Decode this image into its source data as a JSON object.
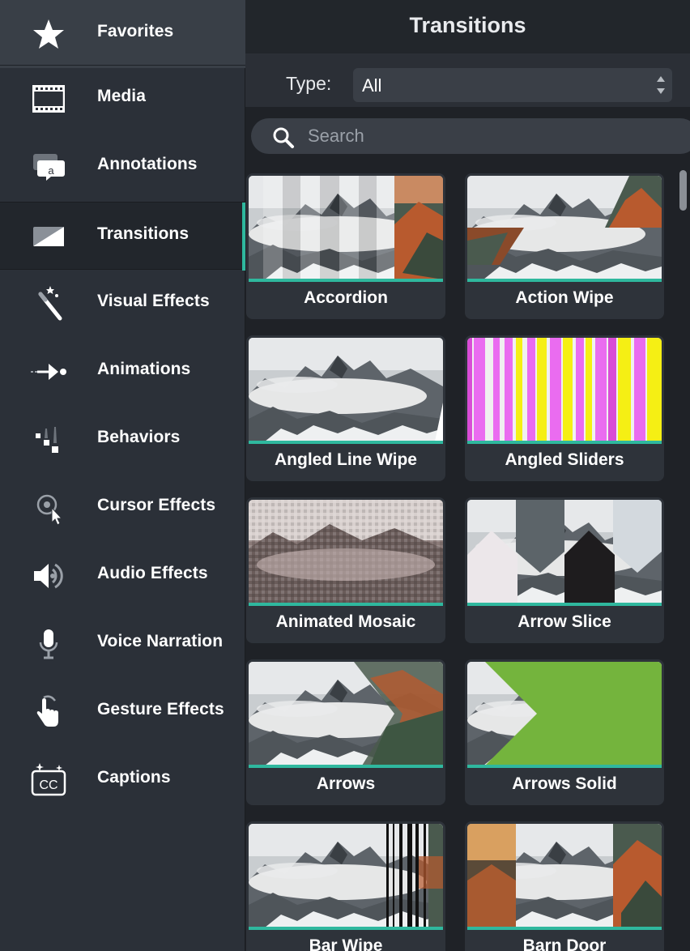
{
  "sidebar": {
    "items": [
      {
        "label": "Favorites",
        "icon": "star-icon"
      },
      {
        "label": "Media",
        "icon": "film-icon"
      },
      {
        "label": "Annotations",
        "icon": "annotation-icon"
      },
      {
        "label": "Transitions",
        "icon": "transition-icon"
      },
      {
        "label": "Visual Effects",
        "icon": "magic-wand-icon"
      },
      {
        "label": "Animations",
        "icon": "animation-arrow-icon"
      },
      {
        "label": "Behaviors",
        "icon": "behaviors-icon"
      },
      {
        "label": "Cursor Effects",
        "icon": "cursor-icon"
      },
      {
        "label": "Audio Effects",
        "icon": "speaker-icon"
      },
      {
        "label": "Voice Narration",
        "icon": "microphone-icon"
      },
      {
        "label": "Gesture Effects",
        "icon": "hand-icon"
      },
      {
        "label": "Captions",
        "icon": "captions-cc-icon"
      }
    ],
    "selected": "Transitions",
    "accent_color": "#2fb89e"
  },
  "header": {
    "title": "Transitions"
  },
  "filter": {
    "type_label": "Type:",
    "type_value": "All"
  },
  "search": {
    "placeholder": "Search"
  },
  "transitions": [
    {
      "name": "Accordion"
    },
    {
      "name": "Action Wipe"
    },
    {
      "name": "Angled Line Wipe"
    },
    {
      "name": "Angled Sliders"
    },
    {
      "name": "Animated Mosaic"
    },
    {
      "name": "Arrow Slice"
    },
    {
      "name": "Arrows"
    },
    {
      "name": "Arrows Solid"
    },
    {
      "name": "Bar Wipe"
    },
    {
      "name": "Barn Door"
    }
  ]
}
